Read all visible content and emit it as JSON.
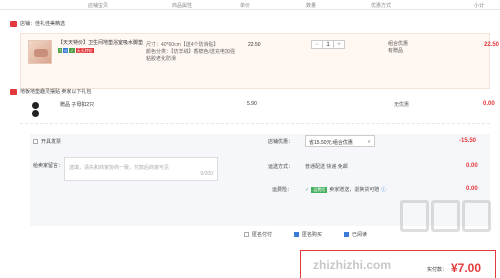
{
  "header": {
    "col_shop": "店铺宝贝",
    "col_props": "商品属性",
    "col_price": "单价",
    "col_qty": "数量",
    "col_promo": "优惠方式",
    "col_subtotal": "小计"
  },
  "shop1": {
    "name": "店铺：佳礼佳美精选"
  },
  "item1": {
    "title": "【天天特价】卫生间地垫浴室吸水脚垫",
    "tags": [
      "7",
      "G",
      "✓",
      "天天特价"
    ],
    "props_line1": "尺寸：40*60cm【送4个防滑贴】",
    "props_line2": "颜色分类：【仿羊绒】香槟色/送充电加强粘胶老化防滑",
    "price": "22.50",
    "quantity": "1",
    "qty_minus": "−",
    "qty_plus": "+",
    "promo_line1": "组合优惠",
    "promo_line2": "有赠品",
    "subtotal": "22.50"
  },
  "shop2": {
    "name": "地板地垫趣灵摆贴  卖家以下礼包"
  },
  "item2": {
    "name": "赠品  子母扣2只",
    "price": "5.90",
    "promo": "无优惠",
    "subtotal": "0.00"
  },
  "order": {
    "invoice_label": "开具发票",
    "message_label": "给卖家留言：",
    "message_placeholder": "选填，请先和商家协商一致，付款后商家可见",
    "message_count": "0/200",
    "shop_discount_label": "店铺优惠：",
    "shop_discount_value": "省15.50元:组合优惠",
    "shop_discount_arrow": "∨",
    "shop_discount_amount": "-15.50",
    "delivery_label": "运送方式：",
    "delivery_value": "普通配送 快递 免邮",
    "delivery_amount": "0.00",
    "insurance_label": "运费险：",
    "insurance_badge": "运费险",
    "insurance_text": "卖家赠送，退换货可赔",
    "insurance_amount": "0.00"
  },
  "bottom": {
    "anonymous_label": "匿名付付",
    "privacy_label": "匿名购买",
    "checked_label": "已阅读"
  },
  "total": {
    "label": "实付款：",
    "amount": "¥7.00"
  },
  "watermark": {
    "text": "zhizhizhi.com"
  }
}
